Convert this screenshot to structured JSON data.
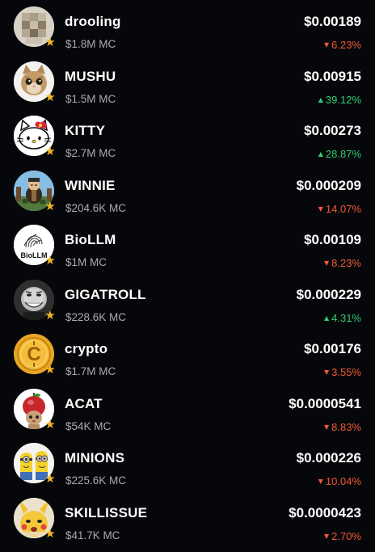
{
  "tokens": [
    {
      "name": "drooling",
      "mc": "$1.8M MC",
      "price": "$0.00189",
      "change": "6.23%",
      "direction": "down",
      "avatar_icon": "blurred-face-icon",
      "badge_icon": "star-icon"
    },
    {
      "name": "MUSHU",
      "mc": "$1.5M MC",
      "price": "$0.00915",
      "change": "39.12%",
      "direction": "up",
      "avatar_icon": "cat-icon",
      "badge_icon": "star-icon"
    },
    {
      "name": "KITTY",
      "mc": "$2.7M MC",
      "price": "$0.00273",
      "change": "28.87%",
      "direction": "up",
      "avatar_icon": "hello-kitty-icon",
      "badge_icon": "star-icon"
    },
    {
      "name": "WINNIE",
      "mc": "$204.6K MC",
      "price": "$0.000209",
      "change": "14.07%",
      "direction": "down",
      "avatar_icon": "cartoon-bear-icon",
      "badge_icon": "star-icon"
    },
    {
      "name": "BioLLM",
      "mc": "$1M MC",
      "price": "$0.00109",
      "change": "8.23%",
      "direction": "down",
      "avatar_icon": "biollm-logo-icon",
      "avatar_text": "BioLLM",
      "badge_icon": "star-icon"
    },
    {
      "name": "GIGATROLL",
      "mc": "$228.6K MC",
      "price": "$0.000229",
      "change": "4.31%",
      "direction": "up",
      "avatar_icon": "trollface-icon",
      "badge_icon": "star-icon"
    },
    {
      "name": "crypto",
      "mc": "$1.7M MC",
      "price": "$0.00176",
      "change": "3.55%",
      "direction": "down",
      "avatar_icon": "gold-coin-icon",
      "badge_icon": "star-icon"
    },
    {
      "name": "ACAT",
      "mc": "$54K MC",
      "price": "$0.0000541",
      "change": "8.83%",
      "direction": "down",
      "avatar_icon": "apple-cat-icon",
      "badge_icon": "star-icon"
    },
    {
      "name": "MINIONS",
      "mc": "$225.6K MC",
      "price": "$0.000226",
      "change": "10.04%",
      "direction": "down",
      "avatar_icon": "minions-icon",
      "badge_icon": "star-icon"
    },
    {
      "name": "SKILLISSUE",
      "mc": "$41.7K MC",
      "price": "$0.0000423",
      "change": "2.70%",
      "direction": "down",
      "avatar_icon": "pikachu-icon",
      "badge_icon": "star-icon"
    }
  ],
  "colors": {
    "background": "#06070a",
    "text_primary": "#ffffff",
    "text_secondary": "#a9abb2",
    "down": "#f05a35",
    "up": "#2fcf72",
    "star": "#f2b526"
  }
}
